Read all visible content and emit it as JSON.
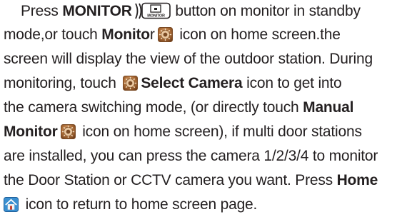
{
  "paragraph": {
    "l1": {
      "t1": "Press ",
      "b1": "MONITOR",
      "t2": " button on monitor in standby"
    },
    "l2": {
      "t1": "mode,or touch ",
      "b1": "Monito",
      "t2": "r",
      "t3": " icon on home screen.the"
    },
    "l3": {
      "t1": "screen will display the view of the outdoor station. During"
    },
    "l4": {
      "t1": "monitoring, touch ",
      "b1": "Select Camera",
      "t2": " icon to get into"
    },
    "l5": {
      "t1": "the camera switching mode, (or directly touch ",
      "b1": "Manual"
    },
    "l6": {
      "b1": "Monitor",
      "t2": " icon on home screen), if multi door stations"
    },
    "l7": {
      "t1": "are installed, you can press the camera 1/2/3/4 to monitor"
    },
    "l8": {
      "t1": "the Door Station or CCTV camera you want. Press ",
      "b1": "Home"
    },
    "l9": {
      "t1": " icon to return to home screen page."
    }
  },
  "icons": {
    "monitor_button_label": "MONITOR",
    "monitor_icon": "camera-gear-icon",
    "home_icon": "home-house-icon"
  },
  "colors": {
    "text": "#231f20",
    "icon_bronze": "#b0703a",
    "home_blue": "#3a8fd0"
  }
}
